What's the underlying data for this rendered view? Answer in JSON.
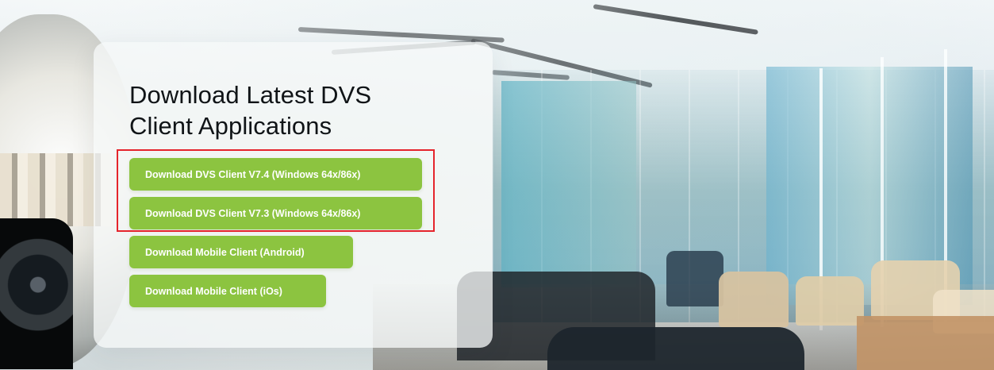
{
  "hero": {
    "title": "Download Latest DVS Client Applications",
    "background_style": "blurred office interior"
  },
  "downloads": [
    {
      "label": "Download DVS Client V7.4 (Windows 64x/86x)"
    },
    {
      "label": "Download DVS Client V7.3 (Windows 64x/86x)"
    },
    {
      "label": "Download Mobile Client (Android)"
    },
    {
      "label": "Download Mobile Client (iOs)"
    }
  ],
  "colors": {
    "button_green": "#8cc440",
    "highlight_red": "#e5242c",
    "title_text": "#101417"
  }
}
